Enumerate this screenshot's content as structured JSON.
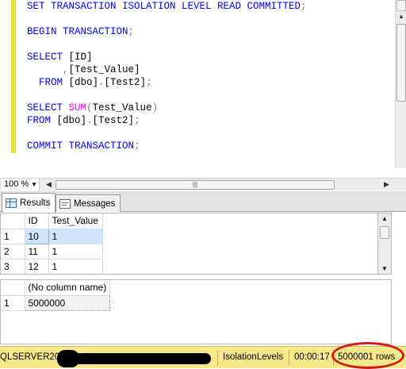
{
  "editor": {
    "lines": [
      [
        {
          "t": "SET TRANSACTION ISOLATION LEVEL READ COMMITTED",
          "c": "kw"
        },
        {
          "t": ";",
          "c": "gr"
        }
      ],
      [],
      [
        {
          "t": "BEGIN TRANSACTION",
          "c": "kw"
        },
        {
          "t": ";",
          "c": "gr"
        }
      ],
      [],
      [
        {
          "t": "SELECT ",
          "c": "kw"
        },
        {
          "t": "[ID]",
          "c": "tx"
        }
      ],
      [
        {
          "t": "      ,",
          "c": "gr"
        },
        {
          "t": "[Test_Value]",
          "c": "tx"
        }
      ],
      [
        {
          "t": "  FROM ",
          "c": "kw"
        },
        {
          "t": "[dbo]",
          "c": "tx"
        },
        {
          "t": ".",
          "c": "gr"
        },
        {
          "t": "[Test2]",
          "c": "tx"
        },
        {
          "t": ";",
          "c": "gr"
        }
      ],
      [],
      [
        {
          "t": "SELECT ",
          "c": "kw"
        },
        {
          "t": "SUM",
          "c": "fn"
        },
        {
          "t": "(",
          "c": "gr"
        },
        {
          "t": "Test_Value",
          "c": "tx"
        },
        {
          "t": ")",
          "c": "gr"
        }
      ],
      [
        {
          "t": "FROM ",
          "c": "kw"
        },
        {
          "t": "[dbo]",
          "c": "tx"
        },
        {
          "t": ".",
          "c": "gr"
        },
        {
          "t": "[Test2]",
          "c": "tx"
        },
        {
          "t": ";",
          "c": "gr"
        }
      ],
      [],
      [
        {
          "t": "COMMIT TRANSACTION",
          "c": "kw"
        },
        {
          "t": ";",
          "c": "gr"
        }
      ]
    ]
  },
  "zoom": {
    "value": "100 %"
  },
  "tabs": {
    "results": "Results",
    "messages": "Messages"
  },
  "grid1": {
    "headers": [
      "ID",
      "Test_Value"
    ],
    "rows": [
      {
        "n": "1",
        "id": "10",
        "val": "1"
      },
      {
        "n": "2",
        "id": "11",
        "val": "1"
      },
      {
        "n": "3",
        "id": "12",
        "val": "1"
      }
    ]
  },
  "grid2": {
    "header": "(No column name)",
    "rows": [
      {
        "n": "1",
        "val": "5000000"
      }
    ]
  },
  "status": {
    "server": "QLSERVER2012",
    "database": "IsolationLevels",
    "elapsed": "00:00:17",
    "rows": "5000001 rows"
  },
  "colors": {
    "status_bg": "#f7e98a",
    "highlight_ring": "#d11a1a",
    "keyword": "#0000ff",
    "function": "#ff00ff"
  }
}
